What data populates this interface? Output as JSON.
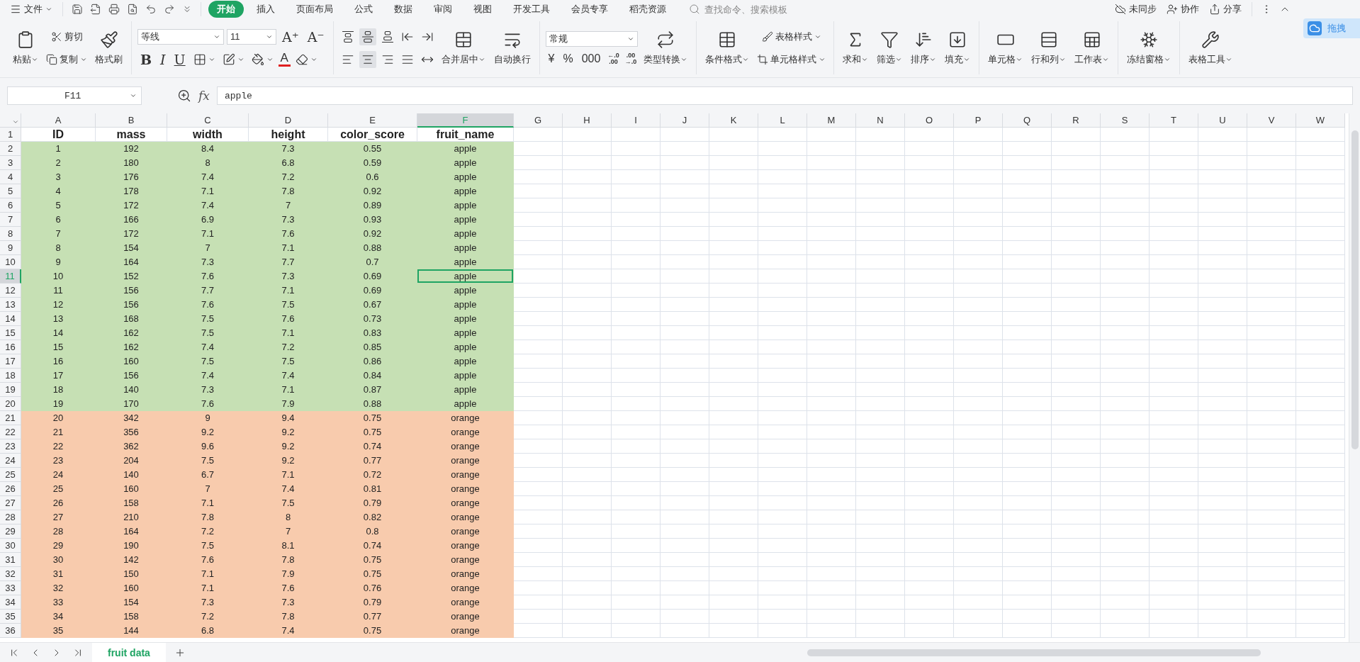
{
  "menu_bar": {
    "file": "文件",
    "tabs": [
      {
        "label": "开始",
        "selected": true
      },
      {
        "label": "插入",
        "selected": false
      },
      {
        "label": "页面布局",
        "selected": false
      },
      {
        "label": "公式",
        "selected": false
      },
      {
        "label": "数据",
        "selected": false
      },
      {
        "label": "审阅",
        "selected": false
      },
      {
        "label": "视图",
        "selected": false
      },
      {
        "label": "开发工具",
        "selected": false
      },
      {
        "label": "会员专享",
        "selected": false
      },
      {
        "label": "稻壳资源",
        "selected": false
      }
    ],
    "search": {
      "placeholder": "查找命令、搜索模板"
    },
    "actions": [
      "未同步",
      "协作",
      "分享"
    ]
  },
  "ribbon": {
    "clipboard": {
      "paste": "粘贴",
      "cut": "剪切",
      "copy": "复制",
      "format_painter": "格式刷"
    },
    "font": {
      "name": "等线",
      "size": "11",
      "grow": "A⁺",
      "shrink": "A⁻",
      "bold": "B",
      "italic": "I",
      "underline": "U",
      "color_letter": "A"
    },
    "alignment": {
      "vertical": [
        {
          "selected": false
        },
        {
          "selected": true
        },
        {
          "selected": false
        }
      ],
      "horizontal": [
        {
          "selected": false
        },
        {
          "selected": true
        },
        {
          "selected": false
        },
        {
          "selected": false
        }
      ],
      "merge": "合并居中",
      "wrap": "自动换行"
    },
    "number": {
      "format": "常规",
      "currency": "¥",
      "percent": "%",
      "thousands": "000",
      "add_decimal": "←.0\n.00",
      "remove_decimal": ".00\n→.0",
      "convert": "类型转换"
    },
    "styles": {
      "conditional": "条件格式",
      "table_style": "表格样式",
      "cell_style": "单元格样式"
    },
    "editing": [
      "求和",
      "筛选",
      "排序",
      "填充"
    ],
    "cells": [
      "单元格",
      "行和列",
      "工作表"
    ],
    "view": [
      "冻结窗格"
    ],
    "tools": [
      "表格工具"
    ],
    "float_button": "拖拽"
  },
  "formula_bar": {
    "name_box": "F11",
    "fx": "fx",
    "value": "apple"
  },
  "sheet": {
    "columns": [
      {
        "letter": "A",
        "selected": false
      },
      {
        "letter": "B",
        "selected": false
      },
      {
        "letter": "C",
        "selected": false
      },
      {
        "letter": "D",
        "selected": false
      },
      {
        "letter": "E",
        "selected": false
      },
      {
        "letter": "F",
        "selected": true
      },
      {
        "letter": "G",
        "selected": false
      },
      {
        "letter": "H",
        "selected": false
      },
      {
        "letter": "I",
        "selected": false
      },
      {
        "letter": "J",
        "selected": false
      },
      {
        "letter": "K",
        "selected": false
      },
      {
        "letter": "L",
        "selected": false
      },
      {
        "letter": "M",
        "selected": false
      },
      {
        "letter": "N",
        "selected": false
      },
      {
        "letter": "O",
        "selected": false
      },
      {
        "letter": "P",
        "selected": false
      },
      {
        "letter": "Q",
        "selected": false
      },
      {
        "letter": "R",
        "selected": false
      },
      {
        "letter": "S",
        "selected": false
      },
      {
        "letter": "T",
        "selected": false
      },
      {
        "letter": "U",
        "selected": false
      },
      {
        "letter": "V",
        "selected": false
      },
      {
        "letter": "W",
        "selected": false
      }
    ],
    "rows": [
      {
        "number": "1",
        "kind": "header",
        "selected": false,
        "cells": [
          "ID",
          "mass",
          "width",
          "height",
          "color_score",
          "fruit_name"
        ]
      },
      {
        "number": "2",
        "kind": "data",
        "selected": false,
        "color": "#c6e0b4",
        "cells": [
          "1",
          "192",
          "8.4",
          "7.3",
          "0.55",
          "apple"
        ]
      },
      {
        "number": "3",
        "kind": "data",
        "selected": false,
        "color": "#c6e0b4",
        "cells": [
          "2",
          "180",
          "8",
          "6.8",
          "0.59",
          "apple"
        ]
      },
      {
        "number": "4",
        "kind": "data",
        "selected": false,
        "color": "#c6e0b4",
        "cells": [
          "3",
          "176",
          "7.4",
          "7.2",
          "0.6",
          "apple"
        ]
      },
      {
        "number": "5",
        "kind": "data",
        "selected": false,
        "color": "#c6e0b4",
        "cells": [
          "4",
          "178",
          "7.1",
          "7.8",
          "0.92",
          "apple"
        ]
      },
      {
        "number": "6",
        "kind": "data",
        "selected": false,
        "color": "#c6e0b4",
        "cells": [
          "5",
          "172",
          "7.4",
          "7",
          "0.89",
          "apple"
        ]
      },
      {
        "number": "7",
        "kind": "data",
        "selected": false,
        "color": "#c6e0b4",
        "cells": [
          "6",
          "166",
          "6.9",
          "7.3",
          "0.93",
          "apple"
        ]
      },
      {
        "number": "8",
        "kind": "data",
        "selected": false,
        "color": "#c6e0b4",
        "cells": [
          "7",
          "172",
          "7.1",
          "7.6",
          "0.92",
          "apple"
        ]
      },
      {
        "number": "9",
        "kind": "data",
        "selected": false,
        "color": "#c6e0b4",
        "cells": [
          "8",
          "154",
          "7",
          "7.1",
          "0.88",
          "apple"
        ]
      },
      {
        "number": "10",
        "kind": "data",
        "selected": false,
        "color": "#c6e0b4",
        "cells": [
          "9",
          "164",
          "7.3",
          "7.7",
          "0.7",
          "apple"
        ]
      },
      {
        "number": "11",
        "kind": "data",
        "selected": true,
        "color": "#c6e0b4",
        "cells": [
          "10",
          "152",
          "7.6",
          "7.3",
          "0.69",
          "apple"
        ]
      },
      {
        "number": "12",
        "kind": "data",
        "selected": false,
        "color": "#c6e0b4",
        "cells": [
          "11",
          "156",
          "7.7",
          "7.1",
          "0.69",
          "apple"
        ]
      },
      {
        "number": "13",
        "kind": "data",
        "selected": false,
        "color": "#c6e0b4",
        "cells": [
          "12",
          "156",
          "7.6",
          "7.5",
          "0.67",
          "apple"
        ]
      },
      {
        "number": "14",
        "kind": "data",
        "selected": false,
        "color": "#c6e0b4",
        "cells": [
          "13",
          "168",
          "7.5",
          "7.6",
          "0.73",
          "apple"
        ]
      },
      {
        "number": "15",
        "kind": "data",
        "selected": false,
        "color": "#c6e0b4",
        "cells": [
          "14",
          "162",
          "7.5",
          "7.1",
          "0.83",
          "apple"
        ]
      },
      {
        "number": "16",
        "kind": "data",
        "selected": false,
        "color": "#c6e0b4",
        "cells": [
          "15",
          "162",
          "7.4",
          "7.2",
          "0.85",
          "apple"
        ]
      },
      {
        "number": "17",
        "kind": "data",
        "selected": false,
        "color": "#c6e0b4",
        "cells": [
          "16",
          "160",
          "7.5",
          "7.5",
          "0.86",
          "apple"
        ]
      },
      {
        "number": "18",
        "kind": "data",
        "selected": false,
        "color": "#c6e0b4",
        "cells": [
          "17",
          "156",
          "7.4",
          "7.4",
          "0.84",
          "apple"
        ]
      },
      {
        "number": "19",
        "kind": "data",
        "selected": false,
        "color": "#c6e0b4",
        "cells": [
          "18",
          "140",
          "7.3",
          "7.1",
          "0.87",
          "apple"
        ]
      },
      {
        "number": "20",
        "kind": "data",
        "selected": false,
        "color": "#c6e0b4",
        "cells": [
          "19",
          "170",
          "7.6",
          "7.9",
          "0.88",
          "apple"
        ]
      },
      {
        "number": "21",
        "kind": "data",
        "selected": false,
        "color": "#f8cbad",
        "cells": [
          "20",
          "342",
          "9",
          "9.4",
          "0.75",
          "orange"
        ]
      },
      {
        "number": "22",
        "kind": "data",
        "selected": false,
        "color": "#f8cbad",
        "cells": [
          "21",
          "356",
          "9.2",
          "9.2",
          "0.75",
          "orange"
        ]
      },
      {
        "number": "23",
        "kind": "data",
        "selected": false,
        "color": "#f8cbad",
        "cells": [
          "22",
          "362",
          "9.6",
          "9.2",
          "0.74",
          "orange"
        ]
      },
      {
        "number": "24",
        "kind": "data",
        "selected": false,
        "color": "#f8cbad",
        "cells": [
          "23",
          "204",
          "7.5",
          "9.2",
          "0.77",
          "orange"
        ]
      },
      {
        "number": "25",
        "kind": "data",
        "selected": false,
        "color": "#f8cbad",
        "cells": [
          "24",
          "140",
          "6.7",
          "7.1",
          "0.72",
          "orange"
        ]
      },
      {
        "number": "26",
        "kind": "data",
        "selected": false,
        "color": "#f8cbad",
        "cells": [
          "25",
          "160",
          "7",
          "7.4",
          "0.81",
          "orange"
        ]
      },
      {
        "number": "27",
        "kind": "data",
        "selected": false,
        "color": "#f8cbad",
        "cells": [
          "26",
          "158",
          "7.1",
          "7.5",
          "0.79",
          "orange"
        ]
      },
      {
        "number": "28",
        "kind": "data",
        "selected": false,
        "color": "#f8cbad",
        "cells": [
          "27",
          "210",
          "7.8",
          "8",
          "0.82",
          "orange"
        ]
      },
      {
        "number": "29",
        "kind": "data",
        "selected": false,
        "color": "#f8cbad",
        "cells": [
          "28",
          "164",
          "7.2",
          "7",
          "0.8",
          "orange"
        ]
      },
      {
        "number": "30",
        "kind": "data",
        "selected": false,
        "color": "#f8cbad",
        "cells": [
          "29",
          "190",
          "7.5",
          "8.1",
          "0.74",
          "orange"
        ]
      },
      {
        "number": "31",
        "kind": "data",
        "selected": false,
        "color": "#f8cbad",
        "cells": [
          "30",
          "142",
          "7.6",
          "7.8",
          "0.75",
          "orange"
        ]
      },
      {
        "number": "32",
        "kind": "data",
        "selected": false,
        "color": "#f8cbad",
        "cells": [
          "31",
          "150",
          "7.1",
          "7.9",
          "0.75",
          "orange"
        ]
      },
      {
        "number": "33",
        "kind": "data",
        "selected": false,
        "color": "#f8cbad",
        "cells": [
          "32",
          "160",
          "7.1",
          "7.6",
          "0.76",
          "orange"
        ]
      },
      {
        "number": "34",
        "kind": "data",
        "selected": false,
        "color": "#f8cbad",
        "cells": [
          "33",
          "154",
          "7.3",
          "7.3",
          "0.79",
          "orange"
        ]
      },
      {
        "number": "35",
        "kind": "data",
        "selected": false,
        "color": "#f8cbad",
        "cells": [
          "34",
          "158",
          "7.2",
          "7.8",
          "0.77",
          "orange"
        ]
      },
      {
        "number": "36",
        "kind": "data",
        "selected": false,
        "color": "#f8cbad",
        "cells": [
          "35",
          "144",
          "6.8",
          "7.4",
          "0.75",
          "orange"
        ]
      }
    ]
  },
  "sheet_tabs": [
    {
      "label": "fruit data",
      "selected": true
    }
  ]
}
